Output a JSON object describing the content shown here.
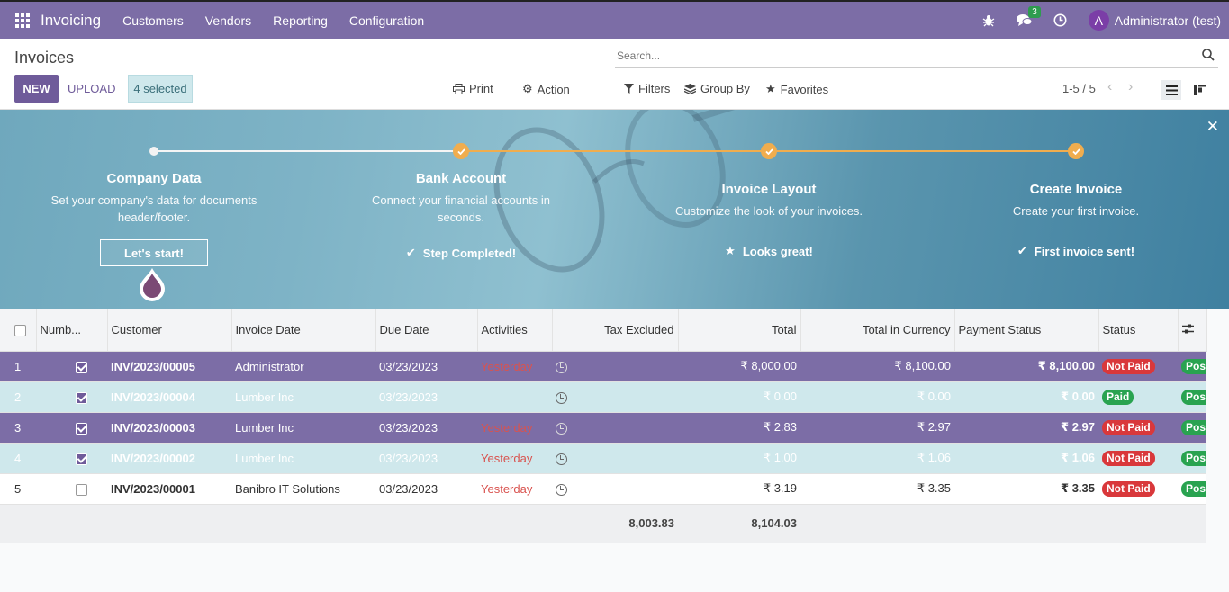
{
  "nav": {
    "app_name": "Invoicing",
    "menu": [
      "Customers",
      "Vendors",
      "Reporting",
      "Configuration"
    ],
    "messages_count": "3",
    "avatar_letter": "A",
    "user_name": "Administrator (test)"
  },
  "control": {
    "breadcrumb": "Invoices",
    "new_label": "NEW",
    "upload_label": "UPLOAD",
    "selected_label": "4 selected",
    "print_label": "Print",
    "action_label": "Action",
    "search_placeholder": "Search...",
    "filters_label": "Filters",
    "groupby_label": "Group By",
    "favorites_label": "Favorites",
    "pager": "1-5 / 5"
  },
  "onboarding": {
    "steps": [
      {
        "title": "Company Data",
        "desc": "Set your company's data for documents header/footer.",
        "action": "Let's start!"
      },
      {
        "title": "Bank Account",
        "desc": "Connect your financial accounts in seconds.",
        "action": "Step Completed!"
      },
      {
        "title": "Invoice Layout",
        "desc": "Customize the look of your invoices.",
        "action": "Looks great!"
      },
      {
        "title": "Create Invoice",
        "desc": "Create your first invoice.",
        "action": "First invoice sent!"
      }
    ],
    "colors": {
      "accent": "#f0ad4e"
    }
  },
  "table": {
    "headers": [
      "Numb...",
      "Customer",
      "Invoice Date",
      "Due Date",
      "Activities",
      "Tax Excluded",
      "Total",
      "Total in Currency",
      "Payment Status",
      "Status"
    ],
    "rows": [
      {
        "idx": "1",
        "checked": true,
        "number": "INV/2023/00005",
        "customer": "Administrator",
        "invoice_date": "03/23/2023",
        "due_date": "Yesterday",
        "tax_excluded": "₹ 8,000.00",
        "total": "₹ 8,100.00",
        "total_currency": "₹ 8,100.00",
        "payment_status": "Not Paid",
        "status": "Post"
      },
      {
        "idx": "2",
        "checked": true,
        "number": "INV/2023/00004",
        "customer": "Lumber Inc",
        "invoice_date": "03/23/2023",
        "due_date": "",
        "tax_excluded": "₹ 0.00",
        "total": "₹ 0.00",
        "total_currency": "₹ 0.00",
        "payment_status": "Paid",
        "status": "Post"
      },
      {
        "idx": "3",
        "checked": true,
        "number": "INV/2023/00003",
        "customer": "Lumber Inc",
        "invoice_date": "03/23/2023",
        "due_date": "Yesterday",
        "tax_excluded": "₹ 2.83",
        "total": "₹ 2.97",
        "total_currency": "₹ 2.97",
        "payment_status": "Not Paid",
        "status": "Post"
      },
      {
        "idx": "4",
        "checked": true,
        "number": "INV/2023/00002",
        "customer": "Lumber Inc",
        "invoice_date": "03/23/2023",
        "due_date": "Yesterday",
        "tax_excluded": "₹ 1.00",
        "total": "₹ 1.06",
        "total_currency": "₹ 1.06",
        "payment_status": "Not Paid",
        "status": "Post"
      },
      {
        "idx": "5",
        "checked": false,
        "number": "INV/2023/00001",
        "customer": "Banibro IT Solutions",
        "invoice_date": "03/23/2023",
        "due_date": "Yesterday",
        "tax_excluded": "₹ 3.19",
        "total": "₹ 3.35",
        "total_currency": "₹ 3.35",
        "payment_status": "Not Paid",
        "status": "Post"
      }
    ],
    "totals": {
      "tax_excluded": "8,003.83",
      "total": "8,104.03"
    }
  }
}
